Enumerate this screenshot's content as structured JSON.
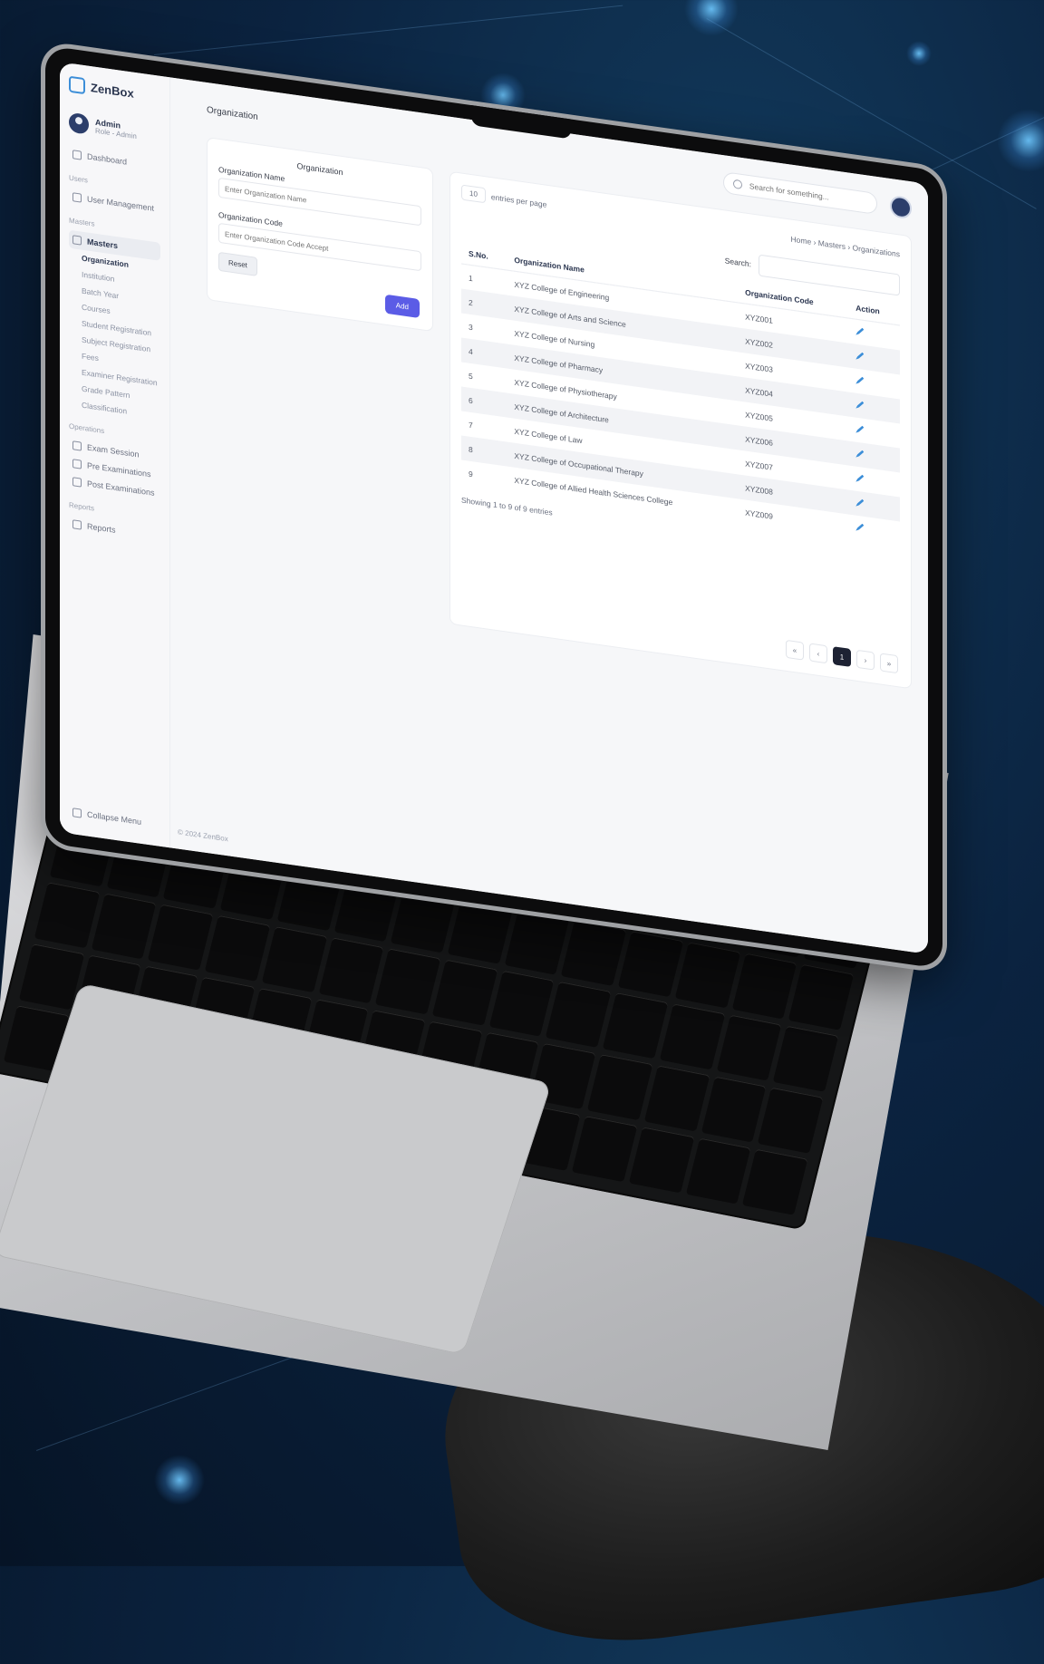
{
  "app": {
    "brand": "ZenBox",
    "page_title": "Organization",
    "footer": "© 2024 ZenBox"
  },
  "user": {
    "name": "Admin",
    "role": "Role - Admin"
  },
  "sidebar": {
    "dashboard": "Dashboard",
    "heading_users": "Users",
    "user_management": "User Management",
    "heading_masters": "Masters",
    "masters": "Masters",
    "masters_items": [
      {
        "label": "Organization",
        "active": true
      },
      {
        "label": "Institution",
        "active": false
      },
      {
        "label": "Batch Year",
        "active": false
      },
      {
        "label": "Courses",
        "active": false
      },
      {
        "label": "Student Registration",
        "active": false
      },
      {
        "label": "Subject Registration",
        "active": false
      },
      {
        "label": "Fees",
        "active": false
      },
      {
        "label": "Examiner Registration",
        "active": false
      },
      {
        "label": "Grade Pattern",
        "active": false
      },
      {
        "label": "Classification",
        "active": false
      }
    ],
    "heading_operations": "Operations",
    "exam_session": "Exam Session",
    "pre_examinations": "Pre Examinations",
    "post_examinations": "Post Examinations",
    "heading_reports": "Reports",
    "reports": "Reports",
    "collapse_menu": "Collapse Menu"
  },
  "header": {
    "search_placeholder": "Search for something...",
    "breadcrumb": "Home  ›  Masters  ›  Organizations"
  },
  "form": {
    "title": "Organization",
    "name_label": "Organization Name",
    "name_placeholder": "Enter Organization Name",
    "code_label": "Organization Code",
    "code_placeholder": "Enter Organization Code Accept",
    "reset_label": "Reset",
    "add_label": "Add"
  },
  "table": {
    "page_size": "10",
    "entries_label": "entries per page",
    "search_label": "Search:",
    "columns": [
      "S.No.",
      "Organization Name",
      "Organization Code",
      "Action"
    ],
    "rows": [
      {
        "sno": "1",
        "name": "XYZ College of Engineering",
        "code": "XYZ001"
      },
      {
        "sno": "2",
        "name": "XYZ College of Arts and Science",
        "code": "XYZ002"
      },
      {
        "sno": "3",
        "name": "XYZ College of Nursing",
        "code": "XYZ003"
      },
      {
        "sno": "4",
        "name": "XYZ College of Pharmacy",
        "code": "XYZ004"
      },
      {
        "sno": "5",
        "name": "XYZ College of Physiotherapy",
        "code": "XYZ005"
      },
      {
        "sno": "6",
        "name": "XYZ College of Architecture",
        "code": "XYZ006"
      },
      {
        "sno": "7",
        "name": "XYZ College of Law",
        "code": "XYZ007"
      },
      {
        "sno": "8",
        "name": "XYZ College of Occupational Therapy",
        "code": "XYZ008"
      },
      {
        "sno": "9",
        "name": "XYZ College of Allied Health Sciences College",
        "code": "XYZ009"
      }
    ],
    "showing": "Showing 1 to 9 of 9 entries",
    "pager": [
      "«",
      "‹",
      "1",
      "›",
      "»"
    ],
    "current_page": "1"
  },
  "colors": {
    "accent": "#5b5ce6",
    "action_icon": "#3c8ed8",
    "background": "#0b2340"
  }
}
